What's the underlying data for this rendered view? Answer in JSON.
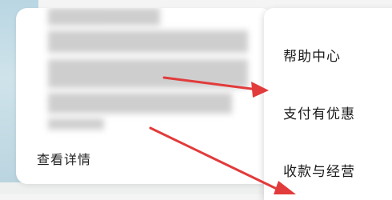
{
  "card": {
    "details_link": "查看详情"
  },
  "menu": {
    "items": [
      {
        "label": "帮助中心"
      },
      {
        "label": "支付有优惠"
      },
      {
        "label": "收款与经营"
      }
    ]
  },
  "annotation": {
    "arrow_color": "#e23b3b"
  }
}
